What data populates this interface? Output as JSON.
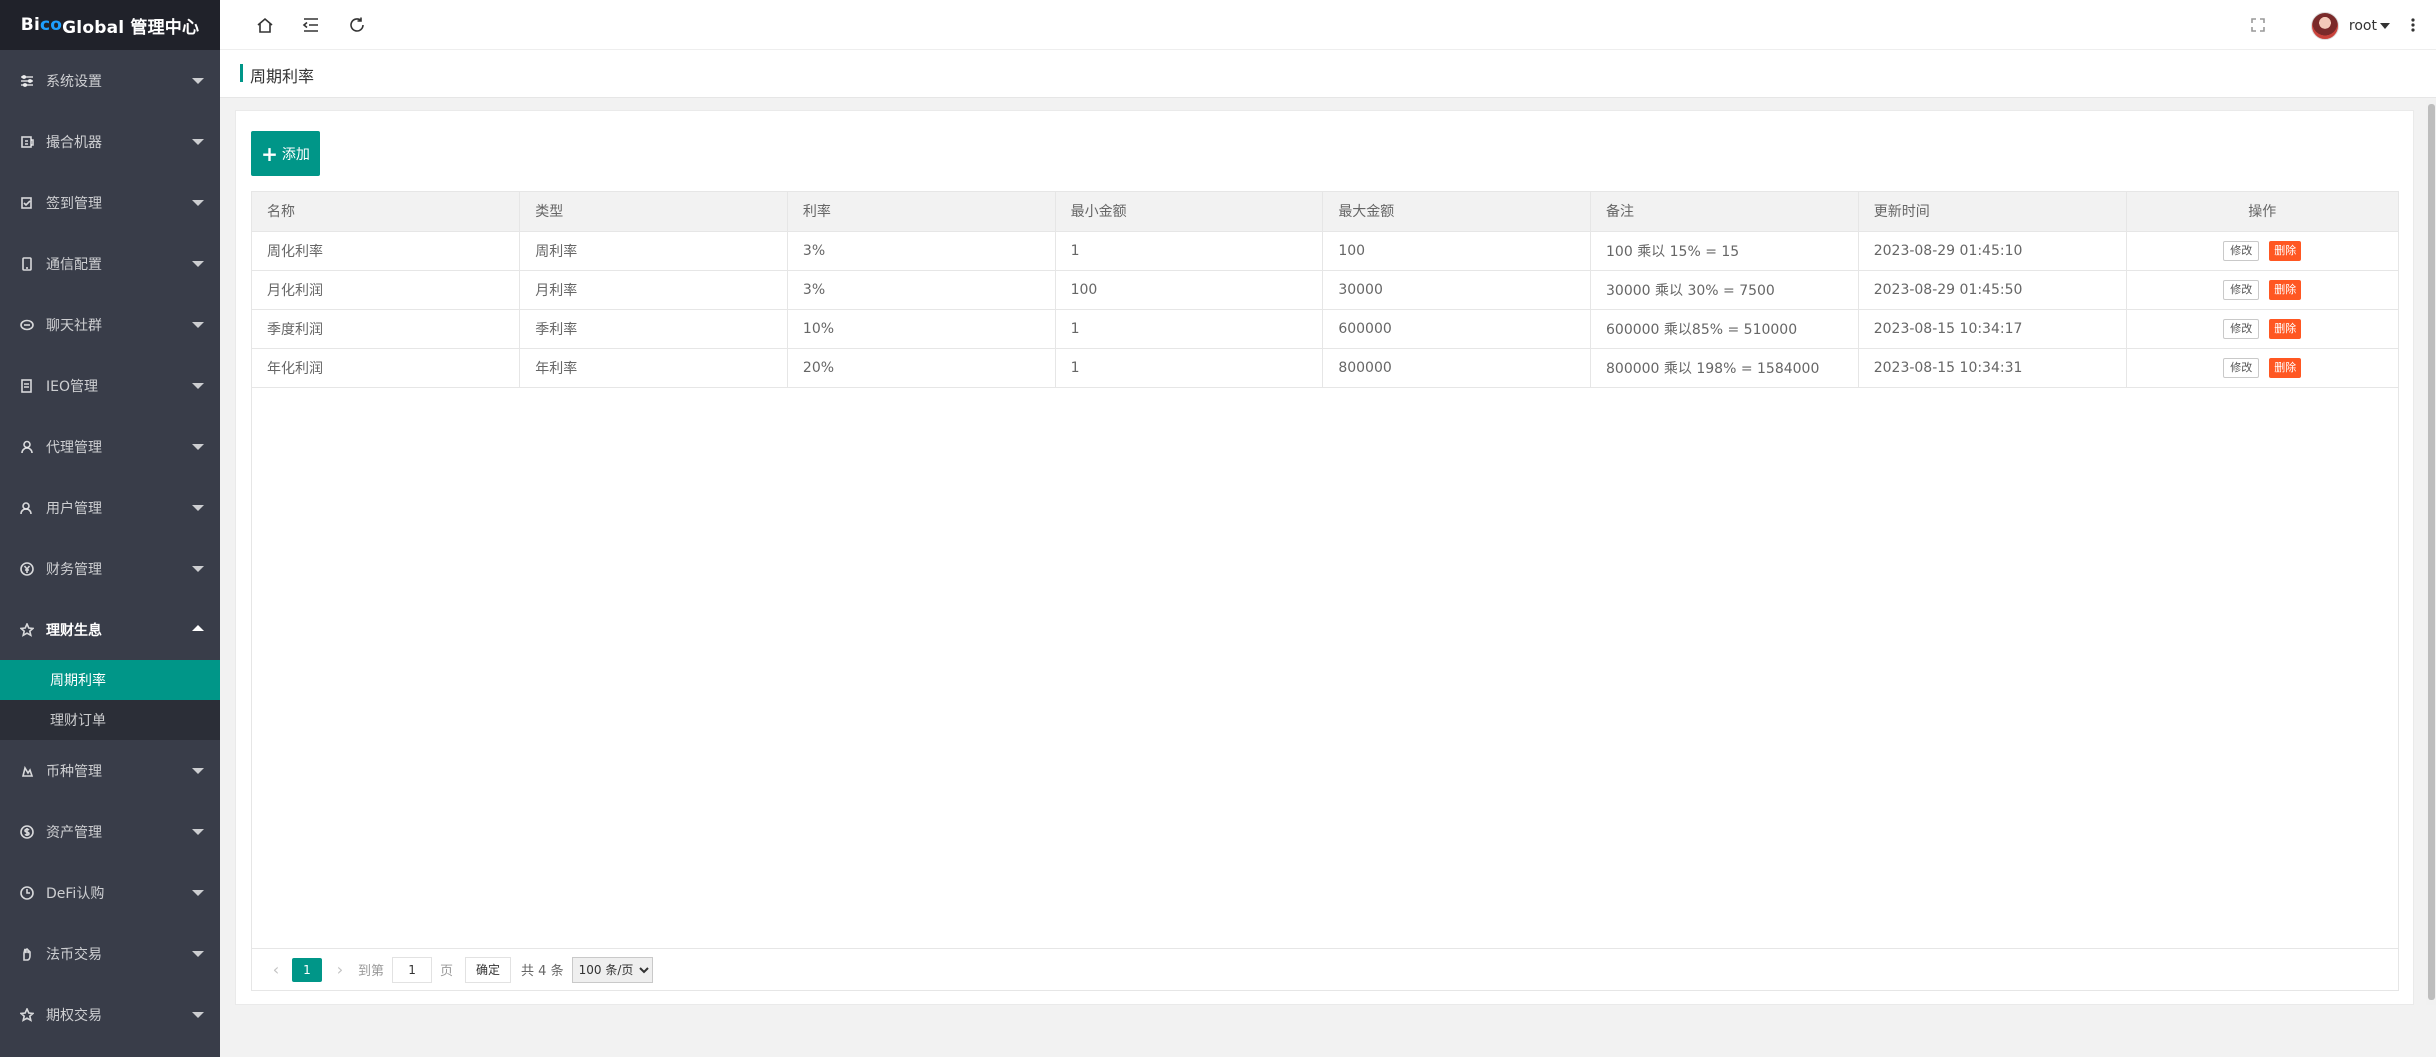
{
  "app": {
    "logo_part1": "Bi",
    "logo_part2": "co",
    "logo_part3": " Global 管理中心"
  },
  "sidebar": {
    "items": [
      {
        "label": "系统设置",
        "icon": "sliders-icon"
      },
      {
        "label": "撮合机器",
        "icon": "robot-icon"
      },
      {
        "label": "签到管理",
        "icon": "checkin-icon"
      },
      {
        "label": "通信配置",
        "icon": "phone-icon"
      },
      {
        "label": "聊天社群",
        "icon": "chat-icon"
      },
      {
        "label": "IEO管理",
        "icon": "doc-icon"
      },
      {
        "label": "代理管理",
        "icon": "user-icon"
      },
      {
        "label": "用户管理",
        "icon": "users-icon"
      },
      {
        "label": "财务管理",
        "icon": "yen-icon"
      },
      {
        "label": "理财生息",
        "icon": "star-icon"
      },
      {
        "label": "币种管理",
        "icon": "coin-icon"
      },
      {
        "label": "资产管理",
        "icon": "dollar-icon"
      },
      {
        "label": "DeFi认购",
        "icon": "clock-icon"
      },
      {
        "label": "法币交易",
        "icon": "hand-icon"
      },
      {
        "label": "期权交易",
        "icon": "star-icon"
      }
    ],
    "submenu": [
      {
        "label": "周期利率"
      },
      {
        "label": "理财订单"
      }
    ]
  },
  "header": {
    "username": "root"
  },
  "breadcrumb": {
    "title": "周期利率"
  },
  "toolbar": {
    "add_label": "添加"
  },
  "table": {
    "columns": [
      "名称",
      "类型",
      "利率",
      "最小金额",
      "最大金额",
      "备注",
      "更新时间",
      "操作"
    ],
    "rows": [
      {
        "name": "周化利率",
        "type": "周利率",
        "rate": "3%",
        "min": "1",
        "max": "100",
        "note": "100 乘以 15% = 15",
        "updated": "2023-08-29 01:45:10"
      },
      {
        "name": "月化利润",
        "type": "月利率",
        "rate": "3%",
        "min": "100",
        "max": "30000",
        "note": "30000 乘以 30% = 7500",
        "updated": "2023-08-29 01:45:50"
      },
      {
        "name": "季度利润",
        "type": "季利率",
        "rate": "10%",
        "min": "1",
        "max": "600000",
        "note": "600000 乘以85% = 510000",
        "updated": "2023-08-15 10:34:17"
      },
      {
        "name": "年化利润",
        "type": "年利率",
        "rate": "20%",
        "min": "1",
        "max": "800000",
        "note": "800000 乘以 198% = 1584000",
        "updated": "2023-08-15 10:34:31"
      }
    ],
    "edit_label": "修改",
    "delete_label": "删除"
  },
  "pager": {
    "prev": "‹",
    "current_page": "1",
    "next": "›",
    "goto_label": "到第",
    "page_input": "1",
    "page_label": "页",
    "confirm_label": "确定",
    "total": "共 4 条",
    "page_size": "100 条/页"
  },
  "colors": {
    "accent": "#009688",
    "danger": "#ff5722",
    "sidebar_bg": "#393d49",
    "logo_bg": "#20222a"
  }
}
